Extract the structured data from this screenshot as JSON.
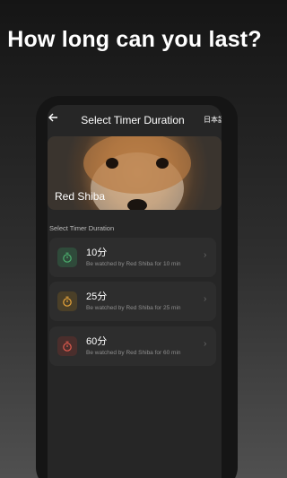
{
  "promo": {
    "headline": "How long can you last?"
  },
  "topbar": {
    "back_icon": "arrow-left-icon",
    "title": "Select Timer Duration",
    "language": "日本語"
  },
  "hero": {
    "name": "Red Shiba"
  },
  "section": {
    "label": "Select Timer Duration"
  },
  "options": [
    {
      "title": "10分",
      "subtitle": "Be watched by Red Shiba for 10 min",
      "icon": "stopwatch-icon",
      "icon_color": "#4caf6e",
      "icon_bg": "#2f4a3a"
    },
    {
      "title": "25分",
      "subtitle": "Be watched by Red Shiba for 25 min",
      "icon": "stopwatch-icon",
      "icon_color": "#e8a53a",
      "icon_bg": "#4a3f28"
    },
    {
      "title": "60分",
      "subtitle": "Be watched by Red Shiba for 60 min",
      "icon": "stopwatch-icon",
      "icon_color": "#e05a4e",
      "icon_bg": "#4a2e2c"
    }
  ],
  "colors": {
    "screen_bg": "#262626",
    "card_bg": "#2d2d2d"
  }
}
